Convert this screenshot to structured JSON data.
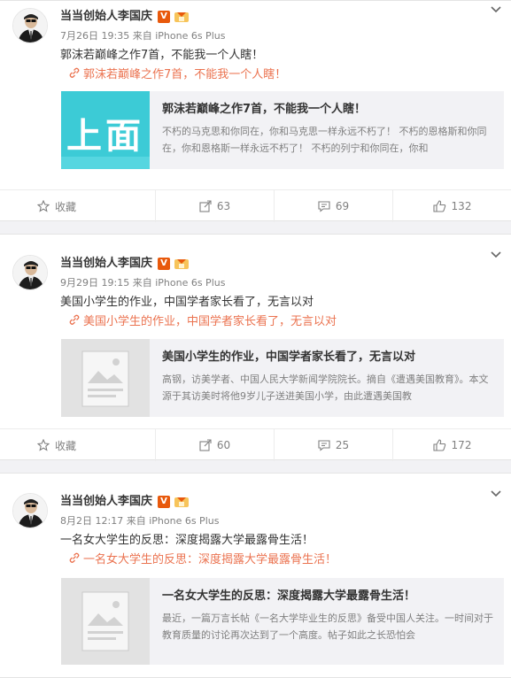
{
  "colors": {
    "link": "#eb7350",
    "verified_badge": "#e8590c",
    "share_bg": "#f2f2f5"
  },
  "icons": {
    "chevron": "chevron-down-icon",
    "link": "link-pin-icon",
    "favorite": "star-icon",
    "repost": "repost-icon",
    "comment": "comment-icon",
    "like": "thumbs-up-icon"
  },
  "posts": [
    {
      "author": "当当创始人李国庆",
      "verified": "V",
      "time": "7月26日 19:35",
      "source_prefix": "来自",
      "source": "iPhone 6s Plus",
      "text": "郭沫若巅峰之作7首，不能我一个人瞎！",
      "link_text": "郭沫若巅峰之作7首，不能我一个人瞎！",
      "share_title": "郭沫若巅峰之作7首，不能我一个人瞎！",
      "share_desc": "不朽的马克思和你同在，你和马克思一样永远不朽了！ 不朽的恩格斯和你同在，你和恩格斯一样永远不朽了！ 不朽的列宁和你同在，你和",
      "thumb_text": "上面",
      "actions": {
        "favorite": "收藏",
        "repost": "63",
        "comment": "69",
        "like": "132"
      }
    },
    {
      "author": "当当创始人李国庆",
      "verified": "V",
      "time": "9月29日 19:15",
      "source_prefix": "来自",
      "source": "iPhone 6s Plus",
      "text": "美国小学生的作业，中国学者家长看了，无言以对",
      "link_text": "美国小学生的作业，中国学者家长看了，无言以对",
      "share_title": "美国小学生的作业，中国学者家长看了，无言以对",
      "share_desc": "高钢，访美学者、中国人民大学新闻学院院长。摘自《遭遇美国教育》。本文源于其访美时将他9岁儿子送进美国小学，由此遭遇美国教",
      "thumb_text": "",
      "actions": {
        "favorite": "收藏",
        "repost": "60",
        "comment": "25",
        "like": "172"
      }
    },
    {
      "author": "当当创始人李国庆",
      "verified": "V",
      "time": "8月2日 12:17",
      "source_prefix": "来自",
      "source": "iPhone 6s Plus",
      "text": "一名女大学生的反思：深度揭露大学最露骨生活！",
      "link_text": "一名女大学生的反思：深度揭露大学最露骨生活！",
      "share_title": "一名女大学生的反思：深度揭露大学最露骨生活！",
      "share_desc": "最近，一篇万言长帖《一名大学毕业生的反思》备受中国人关注。一时间对于教育质量的讨论再次达到了一个高度。帖子如此之长恐怕会",
      "thumb_text": "",
      "actions": {
        "favorite": "",
        "repost": "",
        "comment": "",
        "like": ""
      }
    }
  ]
}
